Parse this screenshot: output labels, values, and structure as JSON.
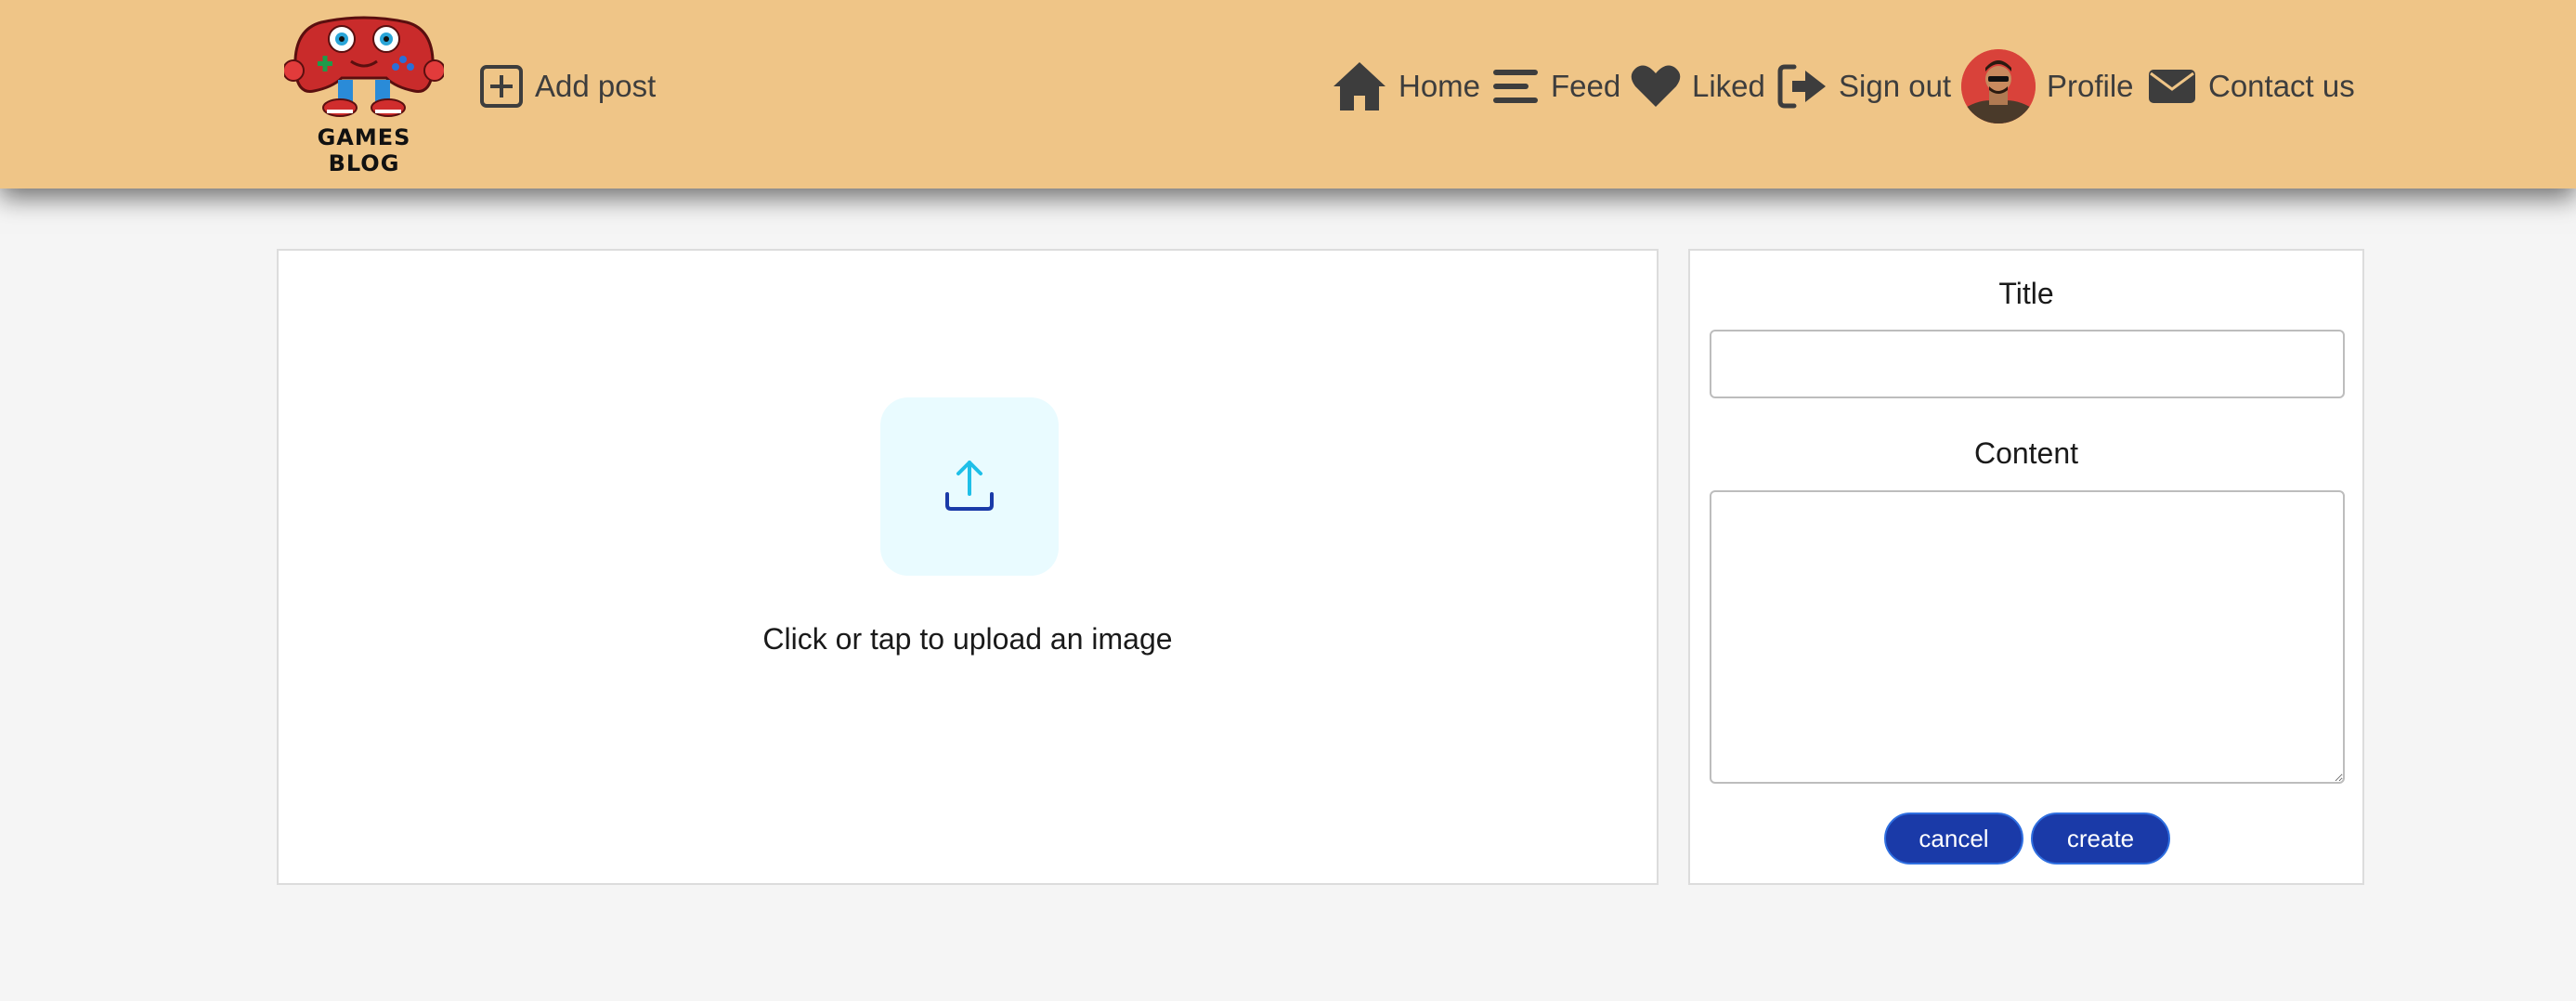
{
  "header": {
    "logo_text": "GAMES BLOG",
    "add_post_label": "Add post",
    "nav": {
      "home": "Home",
      "feed": "Feed",
      "liked": "Liked",
      "sign_out": "Sign out",
      "profile": "Profile",
      "contact": "Contact us"
    }
  },
  "upload": {
    "prompt": "Click or tap to upload an image"
  },
  "form": {
    "title_label": "Title",
    "title_value": "",
    "content_label": "Content",
    "content_value": "",
    "cancel_label": "cancel",
    "create_label": "create"
  },
  "colors": {
    "header_bg": "#efc587",
    "button_bg": "#1a3aa8",
    "upload_bg": "#e9fbff",
    "icon_dark": "#3d3d3d"
  }
}
